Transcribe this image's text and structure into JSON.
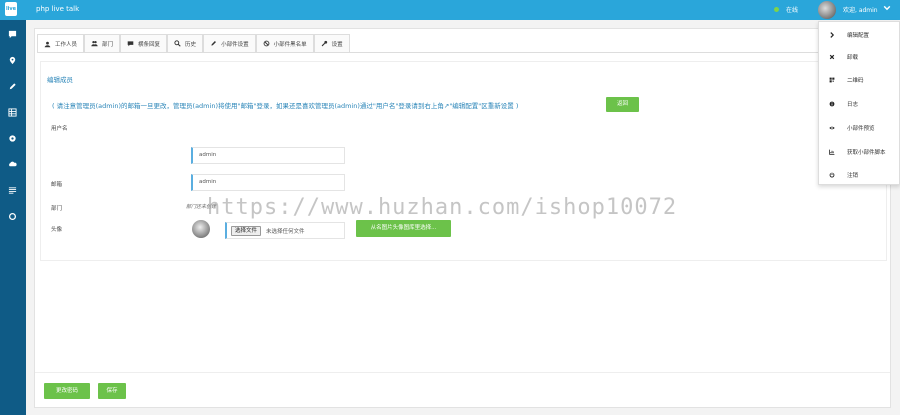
{
  "header": {
    "logo_text": "live",
    "app_title": "php live talk",
    "status_text": "在线",
    "welcome_text": "欢迎, admin"
  },
  "sidebar": {
    "icons": [
      "chat-icon",
      "location-pin-icon",
      "pencil-icon",
      "grid-icon",
      "gear-icon",
      "cloud-icon",
      "list-icon",
      "circle-icon"
    ]
  },
  "tabs": [
    {
      "label": "工作人员",
      "icon": "user-icon",
      "active": true
    },
    {
      "label": "部门",
      "icon": "users-icon",
      "active": false
    },
    {
      "label": "横条回复",
      "icon": "comment-icon",
      "active": false
    },
    {
      "label": "历史",
      "icon": "search-icon",
      "active": false
    },
    {
      "label": "小部件设置",
      "icon": "pencil-icon",
      "active": false
    },
    {
      "label": "小部件黑名单",
      "icon": "ban-icon",
      "active": false
    },
    {
      "label": "设置",
      "icon": "wrench-icon",
      "active": false
    }
  ],
  "form": {
    "section_title": "编辑成员",
    "notice": "( 请注意管理员(admin)的邮箱一旦更改，管理员(admin)将使用\"邮箱\"登录，如果还是喜欢管理员(admin)通过\"用户名\"登录请到右上角↗\"编辑配置\"区重新设置 )",
    "return_label": "返回",
    "username_label": "用户名",
    "username_value": "admin",
    "email_label": "邮箱",
    "email_value": "admin",
    "department_label": "部门",
    "department_value": "部门还未创建",
    "avatar_label": "头像",
    "file_button_label": "选择文件",
    "file_none_text": "未选择任何文件",
    "library_button_label": "从名图片头像图库里选择...",
    "change_password_label": "更改密码",
    "save_label": "保存"
  },
  "watermark": "https://www.huzhan.com/ishop10072",
  "user_menu": [
    {
      "label": "编辑配置",
      "icon": "chevron-right-icon"
    },
    {
      "label": "卸载",
      "icon": "close-icon"
    },
    {
      "label": "二维码",
      "icon": "qrcode-icon"
    },
    {
      "label": "日志",
      "icon": "info-icon"
    },
    {
      "label": "小部件预览",
      "icon": "eye-icon"
    },
    {
      "label": "获取小部件脚本",
      "icon": "code-icon"
    },
    {
      "label": "注销",
      "icon": "power-icon"
    }
  ],
  "colors": {
    "topbar": "#2aa6da",
    "sidebar": "#0f5b86",
    "accent_text": "#2a85b8",
    "button_green": "#6cc24a"
  }
}
